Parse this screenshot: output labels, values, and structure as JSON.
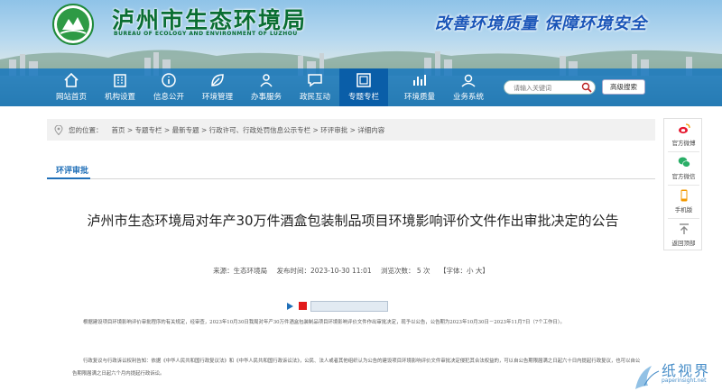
{
  "header": {
    "site_title": "泸州市生态环境局",
    "site_subtitle": "BUREAU OF ECOLOGY AND ENVIRONMENT OF LUZHOU",
    "slogan": "改善环境质量  保障环境安全"
  },
  "nav": {
    "items": [
      {
        "label": "网站首页",
        "icon": "home-icon"
      },
      {
        "label": "机构设置",
        "icon": "building-icon"
      },
      {
        "label": "信息公开",
        "icon": "info-icon"
      },
      {
        "label": "环境管理",
        "icon": "leaf-icon"
      },
      {
        "label": "办事服务",
        "icon": "service-icon"
      },
      {
        "label": "政民互动",
        "icon": "chat-icon"
      },
      {
        "label": "专题专栏",
        "icon": "folder-icon"
      },
      {
        "label": "环境质量",
        "icon": "chart-icon"
      },
      {
        "label": "业务系统",
        "icon": "system-icon"
      }
    ],
    "active_index": 6,
    "search_placeholder": "请输入关键词",
    "advanced_search_label": "高级搜索"
  },
  "breadcrumb": {
    "label": "您的位置：",
    "path": "首页 > 专题专栏 > 最新专题 > 行政许可、行政处罚信息公示专栏 > 环评审批 > 详细内容"
  },
  "section": {
    "tab_label": "环评审批"
  },
  "article": {
    "title": "泸州市生态环境局对年产30万件酒盒包装制品项目环境影响评价文件作出审批决定的公告",
    "source": "来源：生态环境局",
    "published": "发布时间：2023-10-30 11:01",
    "views": "浏览次数： 5  次",
    "font_size": "【字体：小 大】",
    "paragraph1": "根据建设项目环境影响评价审批程序的有关规定，经审查，2023年10月30日我局对年产30万件酒盒包装制品项目环境影响评价文件作出审批决定，现予以公告，公告期为2023年10月30日－2023年11月7日（7个工作日）。",
    "paragraph2": "行政复议与行政诉讼权利告知：依据《中华人民共和国行政复议法》和《中华人民共和国行政诉讼法》，公民、法人或者其他组织认为公告的建设项目环境影响评价文件审批决定侵犯其合法权益的，可以自公告期限届满之日起六十日内提起行政复议，也可以自公告期限届满之日起六个月内提起行政诉讼。"
  },
  "sidebar": {
    "items": [
      {
        "label": "官方微博",
        "icon": "weibo-icon"
      },
      {
        "label": "官方微信",
        "icon": "wechat-icon"
      },
      {
        "label": "手机版",
        "icon": "mobile-icon"
      },
      {
        "label": "返回顶部",
        "icon": "back-to-top-icon"
      }
    ]
  },
  "watermark": {
    "text": "纸视界",
    "url": "paperinsight.net"
  },
  "colors": {
    "nav_bg": "#1978be",
    "nav_active": "#0a5ea8",
    "title_green": "#0a6e33",
    "slogan_blue": "#1a55b8",
    "accent_blue": "#1f6fb8"
  }
}
